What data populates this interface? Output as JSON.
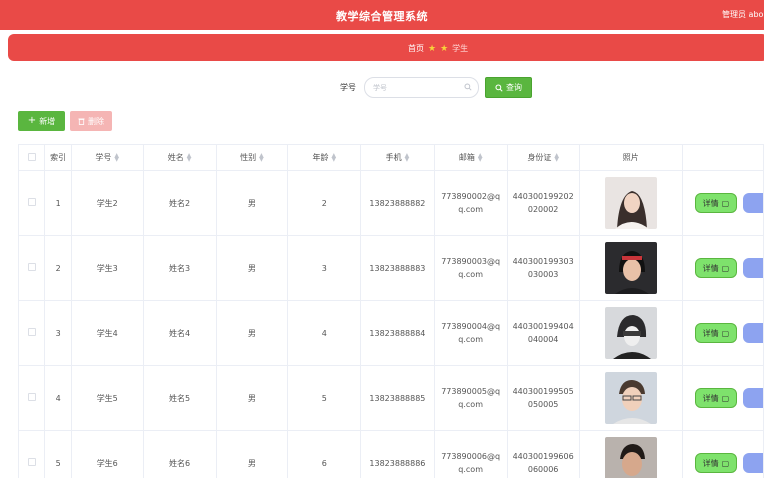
{
  "header": {
    "title": "教学综合管理系统",
    "user": "管理员 abo"
  },
  "breadcrumb": {
    "home": "首页",
    "current": "学生"
  },
  "search": {
    "label": "学号",
    "placeholder": "学号",
    "button": "查询"
  },
  "toolbar": {
    "add_label": "新增",
    "delete_label": "删除"
  },
  "table": {
    "headers": [
      "索引",
      "学号",
      "姓名",
      "性别",
      "年龄",
      "手机",
      "邮箱",
      "身份证",
      "照片"
    ],
    "rows": [
      {
        "index": "1",
        "student_no": "学生2",
        "name": "姓名2",
        "gender": "男",
        "age": "2",
        "phone": "13823888882",
        "email": "773890002@qq.com",
        "id_card": "440300199202020002"
      },
      {
        "index": "2",
        "student_no": "学生3",
        "name": "姓名3",
        "gender": "男",
        "age": "3",
        "phone": "13823888883",
        "email": "773890003@qq.com",
        "id_card": "440300199303030003"
      },
      {
        "index": "3",
        "student_no": "学生4",
        "name": "姓名4",
        "gender": "男",
        "age": "4",
        "phone": "13823888884",
        "email": "773890004@qq.com",
        "id_card": "440300199404040004"
      },
      {
        "index": "4",
        "student_no": "学生5",
        "name": "姓名5",
        "gender": "男",
        "age": "5",
        "phone": "13823888885",
        "email": "773890005@qq.com",
        "id_card": "440300199505050005"
      },
      {
        "index": "5",
        "student_no": "学生6",
        "name": "姓名6",
        "gender": "男",
        "age": "6",
        "phone": "13823888886",
        "email": "773890006@qq.com",
        "id_card": "440300199606060006"
      }
    ],
    "detail_label": "详情"
  },
  "colors": {
    "primary_red": "#e94a47",
    "green": "#5ab63f",
    "detail_green": "#7ee26c",
    "edit_blue": "#8da3f0",
    "delete_pink": "#f5b5b4"
  }
}
